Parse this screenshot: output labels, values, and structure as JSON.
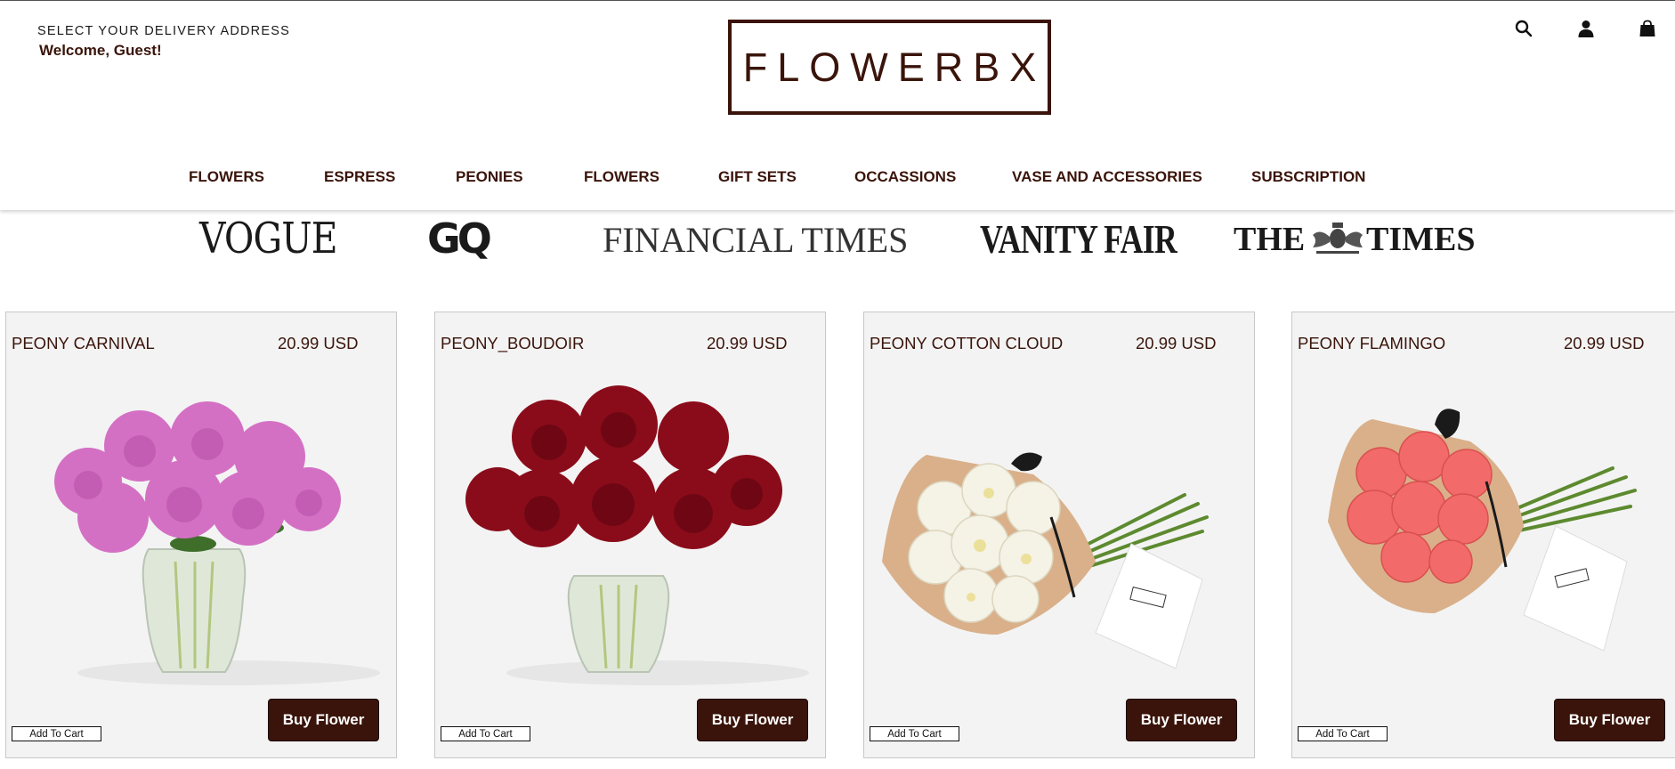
{
  "header": {
    "delivery_label": "SELECT YOUR DELIVERY ADDRESS",
    "welcome": "Welcome, Guest!",
    "logo": "FLOWERBX",
    "icons": [
      "search-icon",
      "user-icon",
      "shopping-bag-icon"
    ]
  },
  "nav": {
    "items": [
      {
        "label": "FLOWERS"
      },
      {
        "label": "ESPRESS"
      },
      {
        "label": "PEONIES"
      },
      {
        "label": "FLOWERS"
      },
      {
        "label": "GIFT SETS"
      },
      {
        "label": "OCCASSIONS"
      },
      {
        "label": "VASE AND ACCESSORIES"
      },
      {
        "label": "SUBSCRIPTION"
      }
    ]
  },
  "press": {
    "logos": [
      "VOGUE",
      "GQ",
      "FINANCIAL TIMES",
      "VANITY FAIR",
      "THE",
      "TIMES"
    ]
  },
  "products": [
    {
      "name": "PEONY CARNIVAL",
      "price": "20.99 USD",
      "add_to_cart": "Add To Cart",
      "buy": "Buy Flower"
    },
    {
      "name": "PEONY_BOUDOIR",
      "price": "20.99 USD",
      "add_to_cart": "Add To Cart",
      "buy": "Buy Flower"
    },
    {
      "name": "PEONY COTTON CLOUD",
      "price": "20.99 USD",
      "add_to_cart": "Add To Cart",
      "buy": "Buy Flower"
    },
    {
      "name": "PEONY FLAMINGO",
      "price": "20.99 USD",
      "add_to_cart": "Add To Cart",
      "buy": "Buy Flower"
    }
  ],
  "colors": {
    "brand": "#3a140a",
    "card_bg": "#f3f3f3",
    "pink_peony": "#d470c4",
    "red_peony": "#8a0c1a",
    "white_peony": "#f5f2e6",
    "coral_peony": "#f26a6a"
  }
}
